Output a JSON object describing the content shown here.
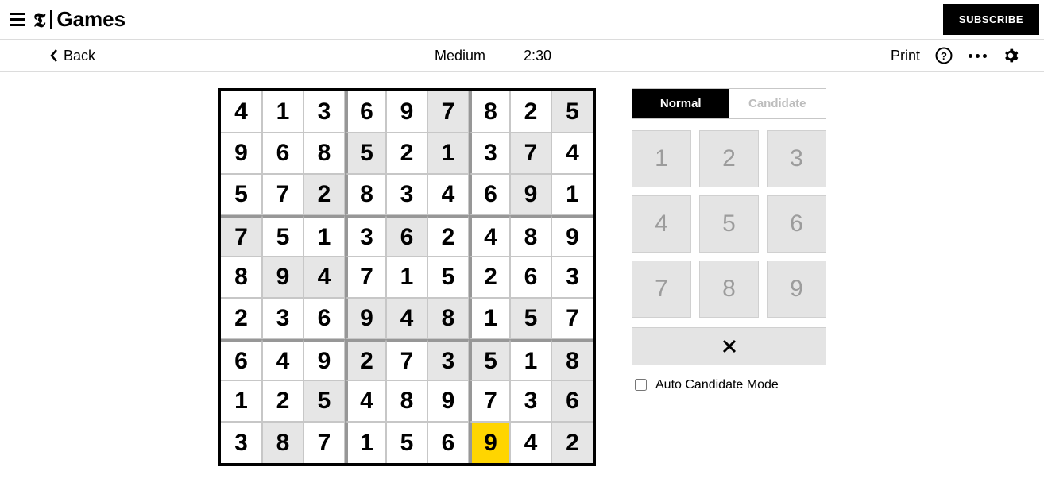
{
  "header": {
    "brand_t": "𝕿",
    "brand_games": "Games",
    "subscribe": "SUBSCRIBE"
  },
  "subbar": {
    "back": "Back",
    "difficulty": "Medium",
    "timer": "2:30",
    "print": "Print"
  },
  "controls": {
    "mode_normal": "Normal",
    "mode_candidate": "Candidate",
    "active_mode": "normal",
    "keys": [
      "1",
      "2",
      "3",
      "4",
      "5",
      "6",
      "7",
      "8",
      "9"
    ],
    "auto_label": "Auto Candidate Mode",
    "auto_checked": false
  },
  "board": {
    "selected": {
      "r": 8,
      "c": 6
    },
    "grid": [
      [
        {
          "v": "4",
          "g": false
        },
        {
          "v": "1",
          "g": false
        },
        {
          "v": "3",
          "g": false
        },
        {
          "v": "6",
          "g": false
        },
        {
          "v": "9",
          "g": false
        },
        {
          "v": "7",
          "g": true
        },
        {
          "v": "8",
          "g": false
        },
        {
          "v": "2",
          "g": false
        },
        {
          "v": "5",
          "g": true
        }
      ],
      [
        {
          "v": "9",
          "g": false
        },
        {
          "v": "6",
          "g": false
        },
        {
          "v": "8",
          "g": false
        },
        {
          "v": "5",
          "g": true
        },
        {
          "v": "2",
          "g": false
        },
        {
          "v": "1",
          "g": true
        },
        {
          "v": "3",
          "g": false
        },
        {
          "v": "7",
          "g": true
        },
        {
          "v": "4",
          "g": false
        }
      ],
      [
        {
          "v": "5",
          "g": false
        },
        {
          "v": "7",
          "g": false
        },
        {
          "v": "2",
          "g": true
        },
        {
          "v": "8",
          "g": false
        },
        {
          "v": "3",
          "g": false
        },
        {
          "v": "4",
          "g": false
        },
        {
          "v": "6",
          "g": false
        },
        {
          "v": "9",
          "g": true
        },
        {
          "v": "1",
          "g": false
        }
      ],
      [
        {
          "v": "7",
          "g": true
        },
        {
          "v": "5",
          "g": false
        },
        {
          "v": "1",
          "g": false
        },
        {
          "v": "3",
          "g": false
        },
        {
          "v": "6",
          "g": true
        },
        {
          "v": "2",
          "g": false
        },
        {
          "v": "4",
          "g": false
        },
        {
          "v": "8",
          "g": false
        },
        {
          "v": "9",
          "g": false
        }
      ],
      [
        {
          "v": "8",
          "g": false
        },
        {
          "v": "9",
          "g": true
        },
        {
          "v": "4",
          "g": true
        },
        {
          "v": "7",
          "g": false
        },
        {
          "v": "1",
          "g": false
        },
        {
          "v": "5",
          "g": false
        },
        {
          "v": "2",
          "g": false
        },
        {
          "v": "6",
          "g": false
        },
        {
          "v": "3",
          "g": false
        }
      ],
      [
        {
          "v": "2",
          "g": false
        },
        {
          "v": "3",
          "g": false
        },
        {
          "v": "6",
          "g": false
        },
        {
          "v": "9",
          "g": true
        },
        {
          "v": "4",
          "g": true
        },
        {
          "v": "8",
          "g": true
        },
        {
          "v": "1",
          "g": false
        },
        {
          "v": "5",
          "g": true
        },
        {
          "v": "7",
          "g": false
        }
      ],
      [
        {
          "v": "6",
          "g": false
        },
        {
          "v": "4",
          "g": false
        },
        {
          "v": "9",
          "g": false
        },
        {
          "v": "2",
          "g": true
        },
        {
          "v": "7",
          "g": false
        },
        {
          "v": "3",
          "g": true
        },
        {
          "v": "5",
          "g": true
        },
        {
          "v": "1",
          "g": false
        },
        {
          "v": "8",
          "g": true
        }
      ],
      [
        {
          "v": "1",
          "g": false
        },
        {
          "v": "2",
          "g": false
        },
        {
          "v": "5",
          "g": true
        },
        {
          "v": "4",
          "g": false
        },
        {
          "v": "8",
          "g": false
        },
        {
          "v": "9",
          "g": false
        },
        {
          "v": "7",
          "g": false
        },
        {
          "v": "3",
          "g": false
        },
        {
          "v": "6",
          "g": true
        }
      ],
      [
        {
          "v": "3",
          "g": false
        },
        {
          "v": "8",
          "g": true
        },
        {
          "v": "7",
          "g": false
        },
        {
          "v": "1",
          "g": false
        },
        {
          "v": "5",
          "g": false
        },
        {
          "v": "6",
          "g": false
        },
        {
          "v": "9",
          "g": false
        },
        {
          "v": "4",
          "g": false
        },
        {
          "v": "2",
          "g": true
        }
      ]
    ]
  }
}
